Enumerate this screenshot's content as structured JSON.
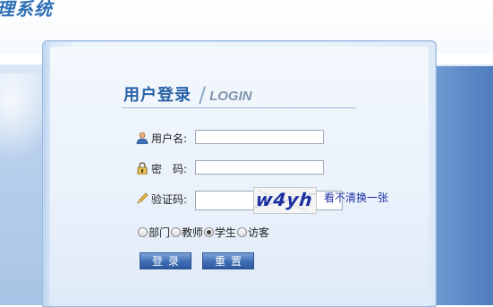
{
  "header": {
    "system_title": "理系统"
  },
  "login": {
    "title_cn": "用户登录",
    "title_en": "LOGIN",
    "username_label": "用户名:",
    "username_value": "",
    "password_label": "密　码:",
    "password_value": "",
    "captcha_label": "验证码:",
    "captcha_value": "",
    "captcha_image_text": "w4yh",
    "refresh_captcha": "看不清换一张",
    "roles": [
      {
        "label": "部门",
        "selected": false
      },
      {
        "label": "教师",
        "selected": false
      },
      {
        "label": "学生",
        "selected": true
      },
      {
        "label": "访客",
        "selected": false
      }
    ],
    "login_button": "登录",
    "reset_button": "重置"
  },
  "colors": {
    "title_blue": "#2a62a6",
    "button_blue": "#3f6db4",
    "link_blue": "#1c2fa0"
  },
  "icons": [
    "user-icon",
    "lock-icon",
    "pencil-icon"
  ]
}
